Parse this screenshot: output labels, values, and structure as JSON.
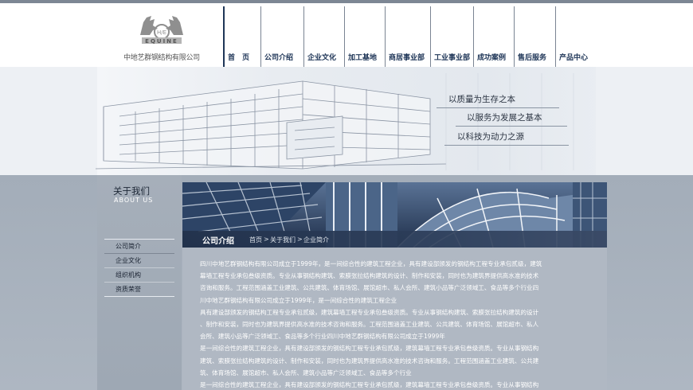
{
  "header": {
    "company_name": "中地艺群钢结构有限公司",
    "logo_text": "EQUINE",
    "logo_badge": "H/E"
  },
  "nav": {
    "items": [
      {
        "label": "首　页"
      },
      {
        "label": "公司介绍"
      },
      {
        "label": "企业文化"
      },
      {
        "label": "加工基地"
      },
      {
        "label": "商居事业部"
      },
      {
        "label": "工业事业部"
      },
      {
        "label": "成功案例"
      },
      {
        "label": "售后服务"
      },
      {
        "label": "产品中心"
      }
    ]
  },
  "hero": {
    "slogans": [
      "以质量为生存之本",
      "以服务为发展之基本",
      "以科技为动力之源"
    ]
  },
  "sidebar": {
    "title": "关于我们",
    "subtitle": "ABOUT US",
    "menu": [
      {
        "label": "公司简介"
      },
      {
        "label": "企业文化"
      },
      {
        "label": "组织机构"
      },
      {
        "label": "资质荣誉"
      }
    ]
  },
  "content": {
    "section_title": "公司介绍",
    "breadcrumb": [
      "首页",
      "关于我们",
      "企业简介"
    ],
    "breadcrumb_sep": ">",
    "lines": [
      "四川中地艺群钢结构有限公司成立于1999年，是一间综合性的建筑工程企业，具有建设部颁发的钢结构工程专业承包贰级，建筑",
      "幕墙工程专业承包叁级资质。专业从事钢结构建筑、索膜张拉结构建筑的设计、制作和安装，同时也为建筑界提供高水准的技术",
      "咨询和服务。工程范围涵盖工业建筑、公共建筑、体育场馆、展馆超市、私人会所、建筑小品等广泛领域工、食品等多个行业四",
      "川中地艺群钢结构有限公司成立于1999年，是一间综合性的建筑工程企业",
      "具有建设部颁发的钢结构工程专业承包贰级，建筑幕墙工程专业承包叁级资质。专业从事钢结构建筑、索膜张拉结构建筑的设计",
      "、制作和安装，同时也为建筑界提供高水准的技术咨询和服务。工程范围涵盖工业建筑、公共建筑、体育场馆、展馆超市、私人",
      "会所、建筑小品等广泛领域工、食品等多个行业四川中地艺群钢结构有限公司成立于1999年",
      "是一间综合性的建筑工程企业，具有建设部颁发的钢结构工程专业承包贰级，建筑幕墙工程专业承包叁级资质。专业从事钢结构",
      "建筑、索膜张拉结构建筑的设计、制作和安装，同时也为建筑界提供高水准的技术咨询和服务。工程范围涵盖工业建筑、公共建",
      "筑、体育场馆、展馆超市、私人会所、建筑小品等广泛领域工、食品等多个行业",
      "是一间综合性的建筑工程企业，具有建设部颁发的钢结构工程专业承包贰级，建筑幕墙工程专业承包叁级资质。专业从事钢结构"
    ]
  },
  "colors": {
    "nav_text": "#1e3557",
    "banner_bar": "#22324c",
    "page_bg": "#aab3be"
  }
}
